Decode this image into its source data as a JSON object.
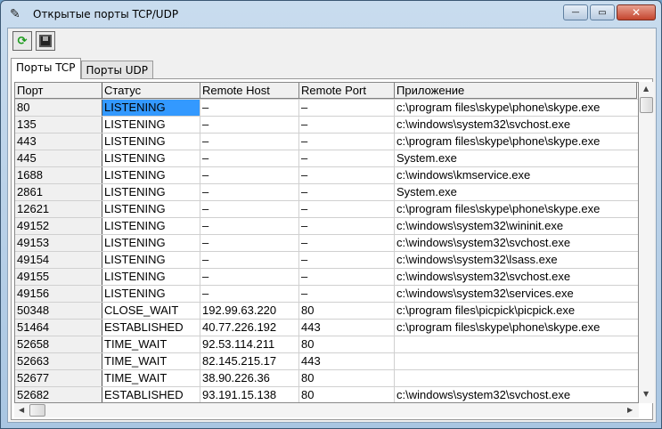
{
  "window": {
    "title": "Открытые порты TCP/UDP",
    "minimize": "—",
    "maximize": "▭",
    "close": "✕"
  },
  "toolbar": {
    "refresh": "⟳",
    "save": "💾"
  },
  "tabs": [
    {
      "label": "Порты TCP"
    },
    {
      "label": "Порты UDP"
    }
  ],
  "columns": [
    "Порт",
    "Статус",
    "Remote Host",
    "Remote Port",
    "Приложение"
  ],
  "rows": [
    [
      "80",
      "LISTENING",
      "–",
      "–",
      "c:\\program files\\skype\\phone\\skype.exe"
    ],
    [
      "135",
      "LISTENING",
      "–",
      "–",
      "c:\\windows\\system32\\svchost.exe"
    ],
    [
      "443",
      "LISTENING",
      "–",
      "–",
      "c:\\program files\\skype\\phone\\skype.exe"
    ],
    [
      "445",
      "LISTENING",
      "–",
      "–",
      "System.exe"
    ],
    [
      "1688",
      "LISTENING",
      "–",
      "–",
      "c:\\windows\\kmservice.exe"
    ],
    [
      "2861",
      "LISTENING",
      "–",
      "–",
      "System.exe"
    ],
    [
      "12621",
      "LISTENING",
      "–",
      "–",
      "c:\\program files\\skype\\phone\\skype.exe"
    ],
    [
      "49152",
      "LISTENING",
      "–",
      "–",
      "c:\\windows\\system32\\wininit.exe"
    ],
    [
      "49153",
      "LISTENING",
      "–",
      "–",
      "c:\\windows\\system32\\svchost.exe"
    ],
    [
      "49154",
      "LISTENING",
      "–",
      "–",
      "c:\\windows\\system32\\lsass.exe"
    ],
    [
      "49155",
      "LISTENING",
      "–",
      "–",
      "c:\\windows\\system32\\svchost.exe"
    ],
    [
      "49156",
      "LISTENING",
      "–",
      "–",
      "c:\\windows\\system32\\services.exe"
    ],
    [
      "50348",
      "CLOSE_WAIT",
      "192.99.63.220",
      "80",
      "c:\\program files\\picpick\\picpick.exe"
    ],
    [
      "51464",
      "ESTABLISHED",
      "40.77.226.192",
      "443",
      "c:\\program files\\skype\\phone\\skype.exe"
    ],
    [
      "52658",
      "TIME_WAIT",
      "92.53.114.211",
      "80",
      ""
    ],
    [
      "52663",
      "TIME_WAIT",
      "82.145.215.17",
      "443",
      ""
    ],
    [
      "52677",
      "TIME_WAIT",
      "38.90.226.36",
      "80",
      ""
    ],
    [
      "52682",
      "ESTABLISHED",
      "93.191.15.138",
      "80",
      "c:\\windows\\system32\\svchost.exe"
    ]
  ]
}
